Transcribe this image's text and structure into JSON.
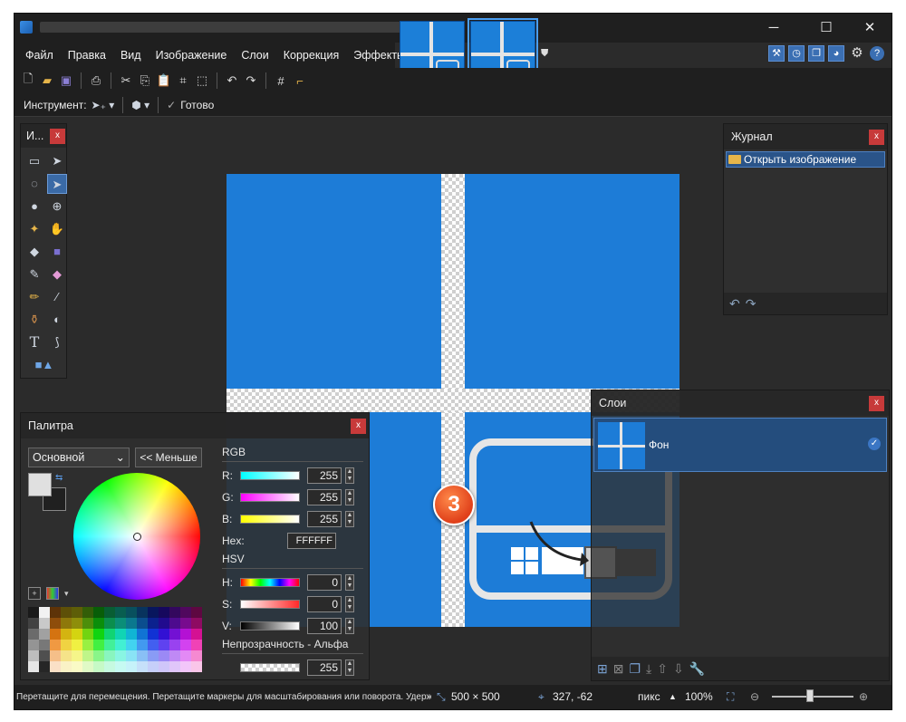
{
  "window": {
    "min_label": "─",
    "max_label": "☐",
    "close_label": "✕"
  },
  "menu": [
    "Файл",
    "Правка",
    "Вид",
    "Изображение",
    "Слои",
    "Коррекция",
    "Эффекты"
  ],
  "toolbar2": {
    "tool_label": "Инструмент:",
    "done_label": "Готово"
  },
  "tools_panel": {
    "title": "И...",
    "close": "x",
    "icons": [
      "rect-select-icon",
      "move-selection-icon",
      "lasso-icon",
      "move-selected-icon",
      "ellipse-select-icon",
      "zoom-icon",
      "magic-wand-icon",
      "pan-icon",
      "paint-bucket-icon",
      "gradient-icon",
      "paintbrush-icon",
      "eraser-icon",
      "pencil-icon",
      "color-picker-icon",
      "clone-stamp-icon",
      "recolor-icon",
      "text-icon",
      "line-curve-icon",
      "shapes-icon"
    ]
  },
  "history": {
    "title": "Журнал",
    "close": "x",
    "items": [
      "Открыть изображение"
    ]
  },
  "layers": {
    "title": "Слои",
    "close": "x",
    "items": [
      {
        "name": "Фон"
      }
    ]
  },
  "palette": {
    "title": "Палитра",
    "close": "x",
    "mode": "Основной",
    "less_button": "<< Меньше",
    "rgb_label": "RGB",
    "r_label": "R:",
    "r": "255",
    "g_label": "G:",
    "g": "255",
    "b_label": "B:",
    "b": "255",
    "hex_label": "Hex:",
    "hex": "FFFFFF",
    "hsv_label": "HSV",
    "h_label": "H:",
    "h": "0",
    "s_label": "S:",
    "s": "0",
    "v_label": "V:",
    "v": "100",
    "alpha_label": "Непрозрачность - Альфа",
    "alpha": "255",
    "primary_color": "#e0e0e0",
    "secondary_color": "#202020"
  },
  "step_badge": "3",
  "status": {
    "hint": "Перетащите для перемещения. Перетащите маркеры для масштабирования или поворота. Удерживайте Shift для ограничения во...",
    "image_size": "500 × 500",
    "cursor": "327, -62",
    "units": "пикс",
    "zoom": "100%"
  },
  "colors": {
    "accent": "#1d7cd7",
    "selection": "#2a5489",
    "close_button": "#c73a3a"
  }
}
